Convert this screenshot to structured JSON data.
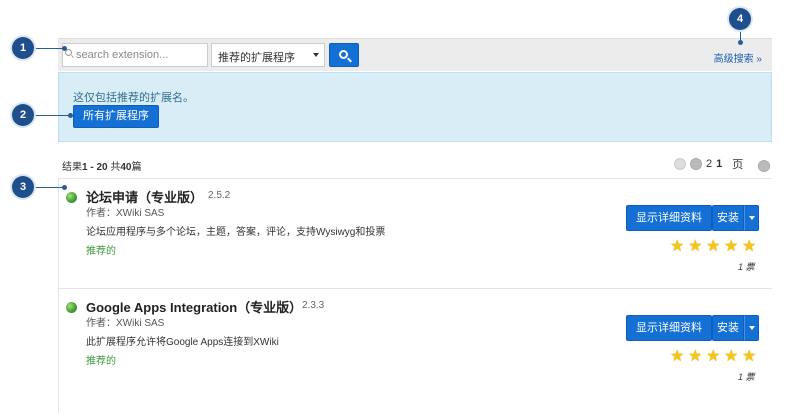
{
  "callouts": [
    "1",
    "2",
    "3",
    "4"
  ],
  "search": {
    "placeholder": "search extension..."
  },
  "filter": {
    "selected": "推荐的扩展程序"
  },
  "advanced_search": "高级搜索 »",
  "info": {
    "text": "这仅包括推荐的扩展名。",
    "button": "所有扩展程序"
  },
  "results": {
    "prefix": "结果",
    "range": "1 - 20",
    "mid": " 共",
    "total": "40",
    "suffix": "篇"
  },
  "pager": {
    "page_a": "2",
    "page_b": "1",
    "label": "页"
  },
  "extensions": [
    {
      "title": "论坛申请（专业版）",
      "version": "2.5.2",
      "author": "作者：XWiki SAS",
      "description": "论坛应用程序与多个论坛，主题，答案，评论，支持Wysiwyg和投票",
      "recommended": "推荐的",
      "details": "显示详细资料",
      "install": "安装",
      "rating": 5,
      "votes": "1 票"
    },
    {
      "title": "Google Apps Integration（专业版）",
      "version": "2.3.3",
      "author": "作者：XWiki SAS",
      "description": "此扩展程序允许将Google Apps连接到XWiki",
      "recommended": "推荐的",
      "details": "显示详细资料",
      "install": "安装",
      "rating": 5,
      "votes": "1 票"
    }
  ],
  "colors": {
    "primary": "#1570d6",
    "info_bg": "#d9edf7",
    "recommended": "#3c9a3c",
    "callout": "#1e4f8c"
  }
}
